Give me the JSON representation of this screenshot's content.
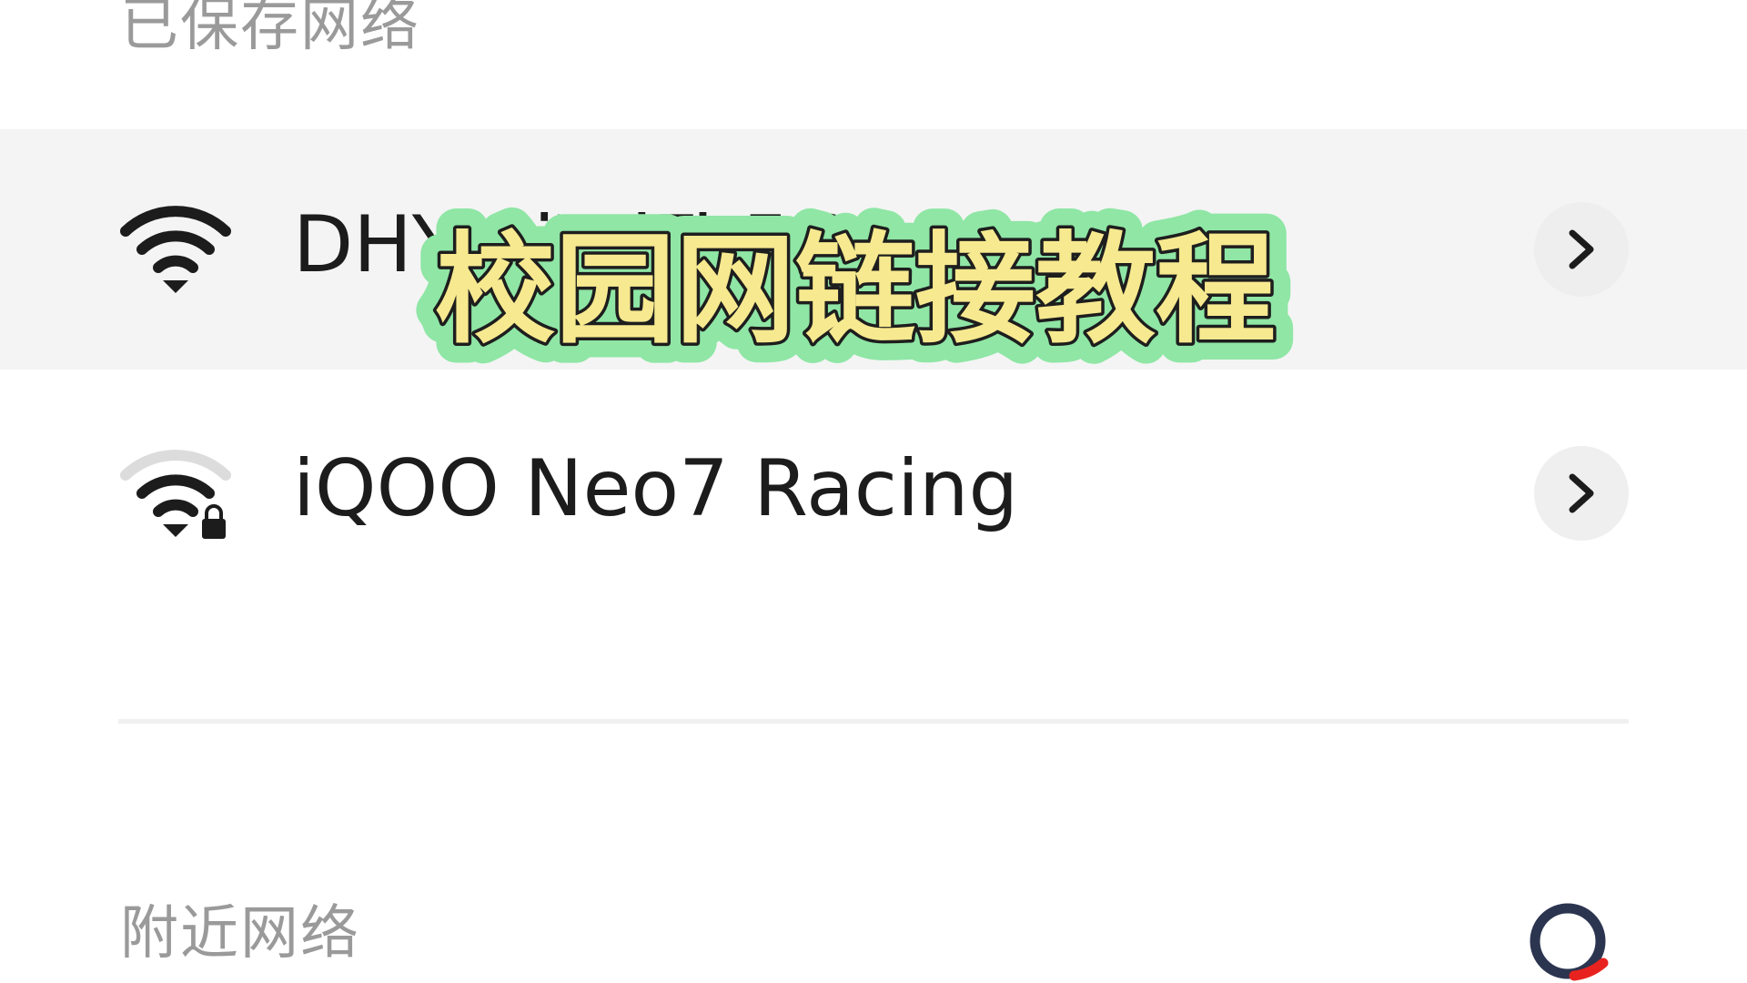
{
  "sections": {
    "saved_title": "已保存网络",
    "nearby_title": "附近网络"
  },
  "saved_networks": [
    {
      "ssid": "DHY-CiWiFi-5G",
      "secured": false,
      "connected": true,
      "signal_bars": 3
    },
    {
      "ssid": "iQOO Neo7 Racing",
      "secured": true,
      "connected": false,
      "signal_bars": 2
    }
  ],
  "overlay": {
    "caption": "校园网链接教程",
    "colors": {
      "fill": "#f7e98f",
      "outline": "#8fe6a5",
      "stroke": "#1e1e1e"
    }
  },
  "icons": {
    "wifi": "wifi-icon",
    "wifi_locked": "wifi-lock-icon",
    "chevron": "chevron-right-icon",
    "spinner": "loading-spinner-icon"
  },
  "colors": {
    "accent_spinner": "#2c3550",
    "spinner_tail": "#e8231f",
    "muted_text": "#9a9a9a",
    "row_highlight": "#f4f4f4"
  }
}
